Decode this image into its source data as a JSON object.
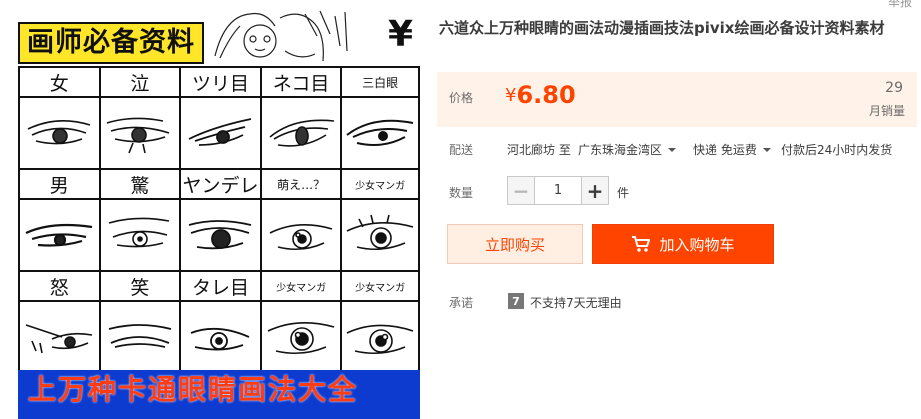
{
  "image": {
    "banner_text": "画师必备资料",
    "grid_labels_row1": [
      "女",
      "泣",
      "ツリ目",
      "ネコ目",
      "三白眼"
    ],
    "grid_labels_row2": [
      "男",
      "驚",
      "ヤンデレ",
      "萌え…？",
      "少女マンガ"
    ],
    "grid_labels_row3": [
      "怒",
      "笑",
      "タレ目",
      "少女マンガ",
      "少女マンガ"
    ],
    "bottom_banner_text": "上万种卡通眼睛画法大全",
    "sketch_mark": "¥"
  },
  "product": {
    "report_link": "举报",
    "title": "六道众上万种眼睛的画法动漫插画技法pivix绘画必备设计资料素材",
    "price_label": "价格",
    "currency_symbol": "¥",
    "price": "6.80",
    "sales_count": "29",
    "sales_label": "月销量",
    "shipping_label": "配送",
    "ship_from": "河北廊坊 至",
    "ship_to": "广东珠海金湾区",
    "delivery_method": "快递 免运费",
    "delivery_time": "付款后24小时内发货",
    "quantity_label": "数量",
    "quantity_minus": "−",
    "quantity_value": "1",
    "quantity_plus": "+",
    "quantity_unit": "件",
    "buy_now_label": "立即购买",
    "add_to_cart_label": "加入购物车",
    "promise_label": "承诺",
    "promise_icon_text": "7",
    "promise_text": "不支持7天无理由"
  },
  "colors": {
    "accent": "#ff4400",
    "price_bg": "#fff2e8",
    "banner_yellow": "#ffe629",
    "banner_blue": "#0d3bd0"
  }
}
